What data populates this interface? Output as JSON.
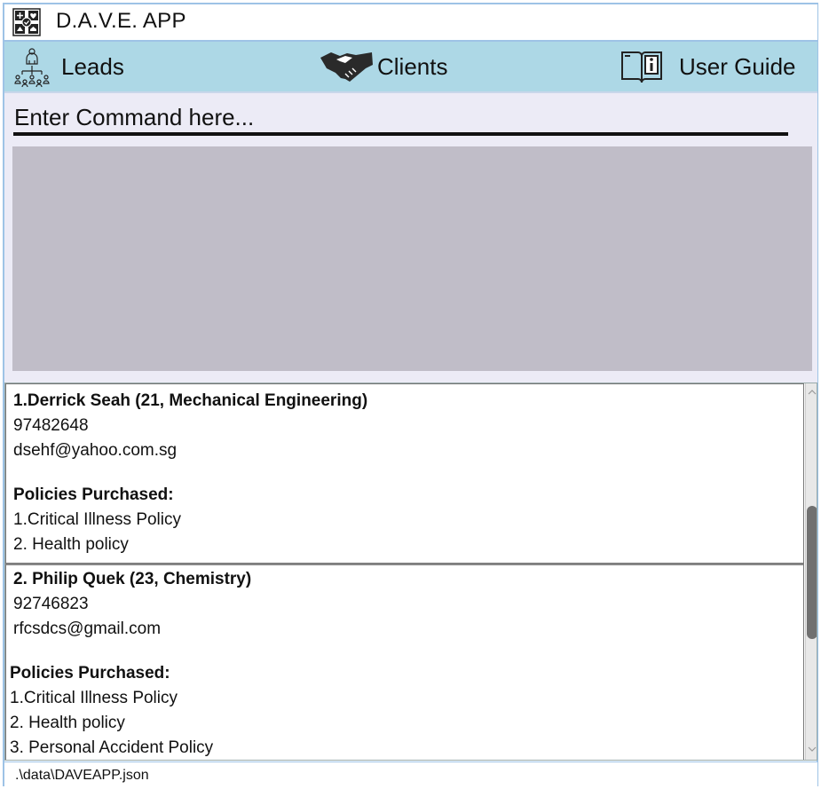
{
  "window": {
    "title": "D.A.V.E. APP",
    "app_icon": "app-logo-icon"
  },
  "nav": {
    "leads": {
      "label": "Leads",
      "icon": "hierarchy-people-icon"
    },
    "clients": {
      "label": "Clients",
      "icon": "handshake-icon"
    },
    "guide": {
      "label": "User Guide",
      "icon": "book-info-icon"
    }
  },
  "command": {
    "placeholder": "Enter Command here...",
    "value": ""
  },
  "clients": [
    {
      "header": "1.Derrick Seah (21, Mechanical Engineering)",
      "phone": "97482648",
      "email": "dsehf@yahoo.com.sg",
      "policies_title": "Policies Purchased:",
      "policies": [
        "1.Critical Illness Policy",
        "2. Health policy"
      ]
    },
    {
      "header": "2. Philip Quek (23, Chemistry)",
      "phone": "92746823",
      "email": "rfcsdcs@gmail.com",
      "policies_title": "Policies Purchased:",
      "policies": [
        "1.Critical Illness Policy",
        "2. Health policy",
        "3. Personal Accident Policy"
      ]
    }
  ],
  "status": {
    "file_path": ".\\data\\DAVEAPP.json"
  },
  "colors": {
    "nav_bg": "#add8e6",
    "command_bg": "#ecebf6",
    "result_bg": "#c0bdc8",
    "frame": "#9ec3e6"
  }
}
